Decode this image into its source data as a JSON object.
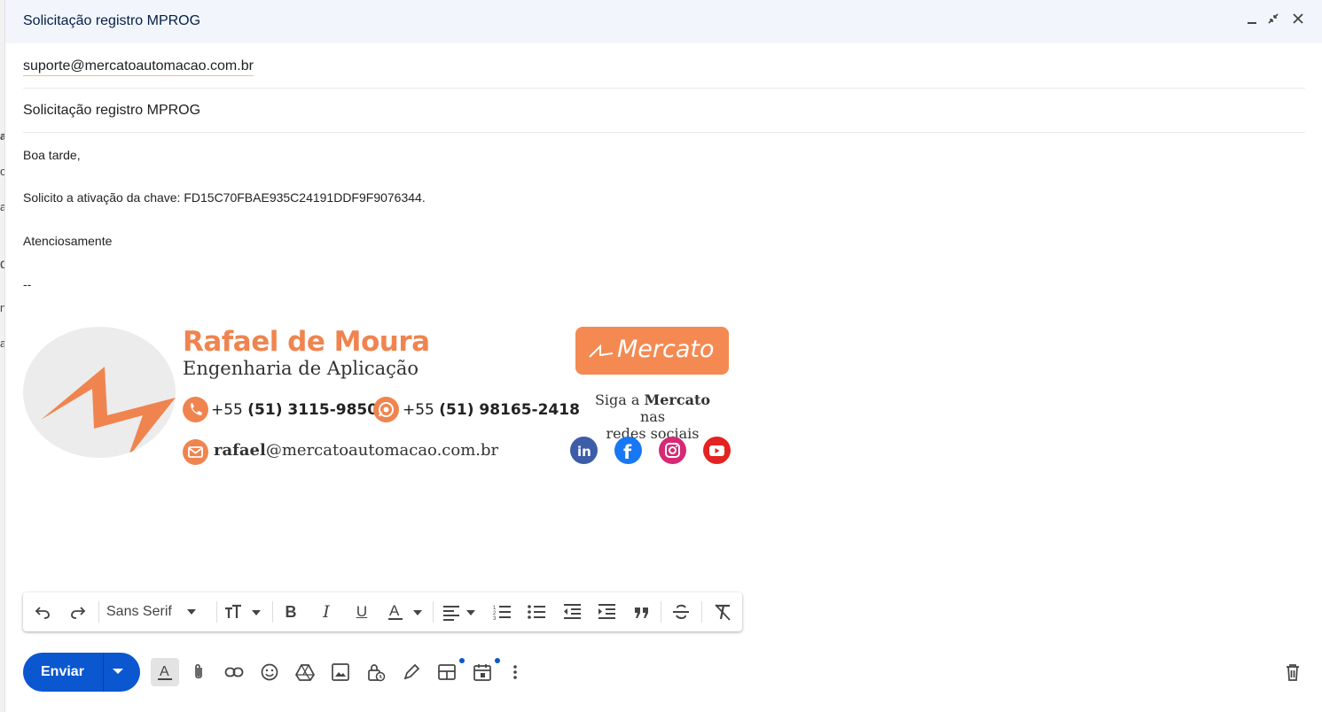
{
  "window": {
    "title": "Solicitação registro MPROG",
    "minimize_icon": "minimize-icon",
    "exit_fullscreen_icon": "exit-fullscreen-icon",
    "close_icon": "close-icon"
  },
  "recipients": {
    "to": "suporte@mercatoautomacao.com.br"
  },
  "subject": "Solicitação registro MPROG",
  "body": {
    "greeting": "Boa tarde,",
    "line1": "Solicito a ativação da chave: FD15C70FBAE935C24191DDF9F9076344.",
    "closing": "Atenciosamente",
    "separator": "--"
  },
  "signature": {
    "name": "Rafael de Moura",
    "role": "Engenharia de Aplicação",
    "phone1_prefix": "+55 ",
    "phone1_number": "(51) 3115-9850",
    "phone2_prefix": "+55 ",
    "phone2_number": "(51) 98165-2418",
    "email_user": "rafael",
    "email_domain": "@mercatoautomacao.com.br",
    "logo_text": "Mercato",
    "follow_prefix": "Siga a ",
    "follow_brand": "Mercato",
    "follow_suffix": " nas",
    "follow_line2": "redes sociais",
    "social": [
      "linkedin-icon",
      "facebook-icon",
      "instagram-icon",
      "youtube-icon"
    ],
    "colors": {
      "accent": "#f0844f",
      "linkedin": "#3d5da8",
      "facebook": "#1877f2",
      "instagram": "#d62976",
      "youtube": "#e52222"
    }
  },
  "format_toolbar": {
    "font_family": "Sans Serif"
  },
  "bottom_bar": {
    "send_label": "Enviar",
    "colors": {
      "send": "#0b57d0"
    }
  }
}
